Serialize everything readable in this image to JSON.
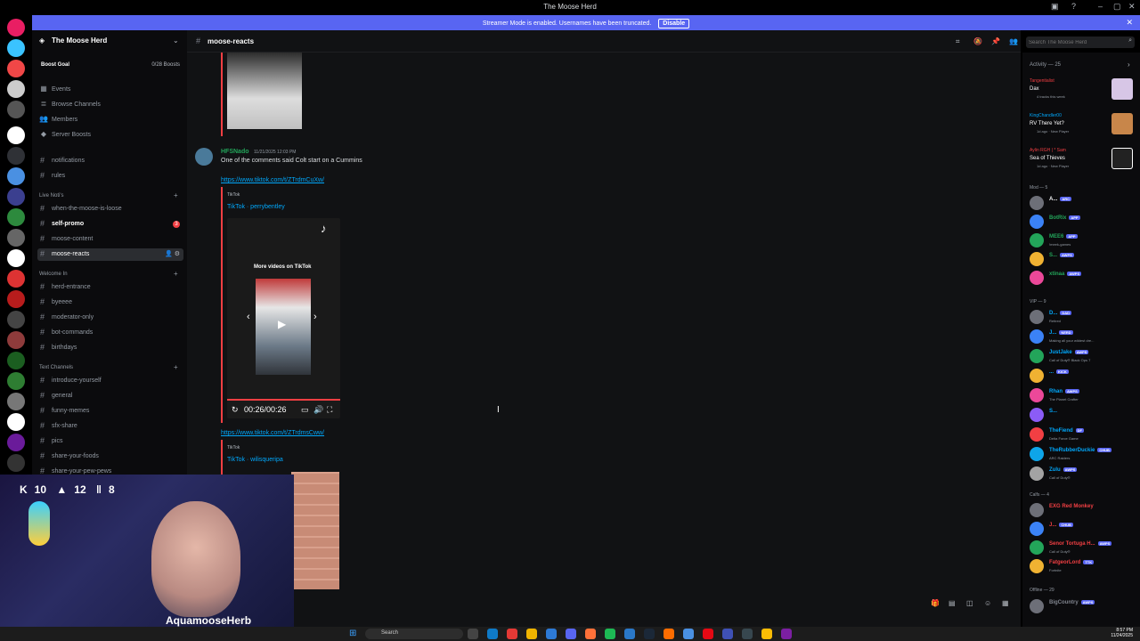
{
  "window": {
    "title": "The Moose Herd"
  },
  "banner": {
    "text": "Streamer Mode is enabled. Usernames have been truncated.",
    "button": "Disable"
  },
  "server": {
    "name": "The Moose Herd",
    "boost_label": "Boost Goal",
    "boost_count": "0/28 Boosts"
  },
  "nav": {
    "events": "Events",
    "browse": "Browse Channels",
    "members": "Members",
    "boosts": "Server Boosts"
  },
  "channels_top": [
    "notifications",
    "rules"
  ],
  "cat_live": "Live Noti's",
  "channels_live": [
    "when-the-moose-is-loose",
    "self-promo",
    "moose-content",
    "moose-reacts"
  ],
  "selfpromo_badge": "3",
  "cat_welcome": "Welcome In",
  "channels_welcome": [
    "herd-entrance",
    "byeeee",
    "moderator-only",
    "bot-commands",
    "birthdays"
  ],
  "cat_text": "Text Channels",
  "channels_text": [
    "introduce-yourself",
    "general",
    "funny-memes",
    "sfx-share",
    "pics",
    "share-your-foods",
    "share-your-pew-pews"
  ],
  "header": {
    "channel": "moose-reacts",
    "search_placeholder": "Search The Moose Herd"
  },
  "message": {
    "author": "HFSNado",
    "timestamp": "11/21/2025 12:03 PM",
    "text": "One of the comments said Colt start on a Cummins",
    "link1": "https://www.tiktok.com/t/ZTrdmCuXw/",
    "embed1_site": "TikTok",
    "embed1_author": "TikTok · perrybentley",
    "more_videos": "More videos on TikTok",
    "time": "00:26/00:26",
    "link2": "https://www.tiktok.com/t/ZTrdmsCww/",
    "embed2_site": "TikTok",
    "embed2_author": "TikTok · wilisqueripa"
  },
  "webcam": {
    "stat1": "10",
    "stat2": "12",
    "stat3": "8",
    "handle": "AquamooseHerb"
  },
  "members": {
    "activity_header": "Activity — 25",
    "activities": [
      {
        "who": "Tangentialist",
        "title": "Dax",
        "sub": "4 tracks this week"
      },
      {
        "who": "KingChandler00",
        "title": "RV There Yet?",
        "sub": "1d ago · New Player"
      },
      {
        "who": "Aylin RGH | * Sam",
        "title": "Sea of Thieves",
        "sub": "1d ago · New Player"
      }
    ],
    "mod_header": "Mod — 5",
    "mods": [
      {
        "name": "A...",
        "tag": "ARC",
        "status": "",
        "color": "#f2f3f5"
      },
      {
        "name": "BotRix",
        "tag": "APP",
        "status": "",
        "color": "#23a55a"
      },
      {
        "name": "MEE6",
        "tag": "APP",
        "status": "!meek-games",
        "color": "#23a55a"
      },
      {
        "name": "S...",
        "tag": "AWPS",
        "status": "",
        "color": "#23a55a"
      },
      {
        "name": "xtinaa",
        "tag": "AWPS",
        "status": "",
        "color": "#23a55a"
      }
    ],
    "vip_header": "VIP — 9",
    "vips": [
      {
        "name": "D...",
        "tag": "DAD",
        "status": "Retired",
        "color": "#00a8fc"
      },
      {
        "name": "J...",
        "tag": "NERD",
        "status": "Making all your wildest dre...",
        "color": "#00a8fc"
      },
      {
        "name": "JustJake",
        "tag": "AWPS",
        "status": "Call of Duty® Black Ops 7",
        "color": "#00a8fc"
      },
      {
        "name": "...",
        "tag": "KICK",
        "status": "",
        "color": "#00a8fc"
      },
      {
        "name": "Rhan",
        "tag": "AWPS",
        "status": "The Planet Crafter",
        "color": "#00a8fc"
      },
      {
        "name": "S...",
        "tag": "",
        "status": "",
        "color": "#00a8fc"
      },
      {
        "name": "TheFiend",
        "tag": "DF",
        "status": "Delta Force Game",
        "color": "#00a8fc"
      },
      {
        "name": "TheRubberDuckie",
        "tag": "CHUB",
        "status": "ARC Raiders",
        "color": "#00a8fc"
      },
      {
        "name": "Zulu",
        "tag": "AWPS",
        "status": "Call of Duty®",
        "color": "#00a8fc"
      }
    ],
    "calfs_header": "Calfs — 4",
    "calfs": [
      {
        "name": "EXG Red Monkey",
        "tag": "",
        "status": "",
        "color": "#f23f43"
      },
      {
        "name": "J...",
        "tag": "CHUB",
        "status": "",
        "color": "#f23f43"
      },
      {
        "name": "Senor Tortuga H...",
        "tag": "AWPS",
        "status": "Call of Duty®",
        "color": "#f23f43"
      },
      {
        "name": "FatgeorLord",
        "tag": "TTK",
        "status": "Fortnite",
        "color": "#f23f43"
      }
    ],
    "offline_header": "Offline — 29",
    "offline": [
      {
        "name": "BigCountry",
        "tag": "AWPS",
        "status": "",
        "color": "#80848e"
      }
    ]
  },
  "taskbar": {
    "search": "Search",
    "time": "8:57 PM",
    "date": "11/24/2025"
  },
  "colors": {
    "brand": "#5865f2",
    "accent_red": "#f23f43",
    "link": "#00a8fc",
    "online": "#23a55a"
  }
}
